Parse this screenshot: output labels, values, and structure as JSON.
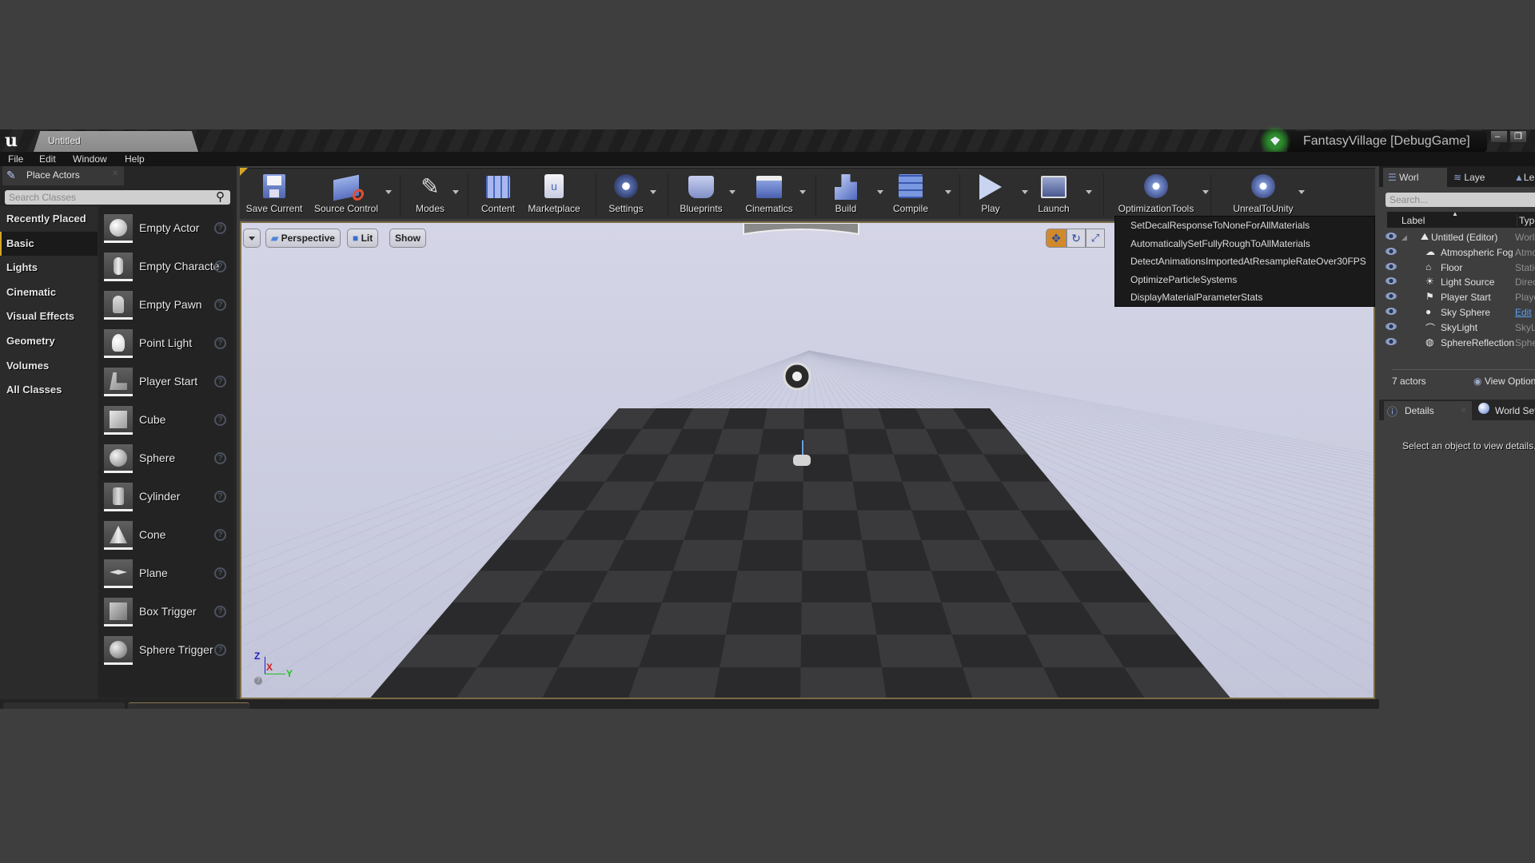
{
  "window": {
    "document_tab": "Untitled",
    "project_name": "FantasyVillage [DebugGame]",
    "minimize_glyph": "–",
    "restore_glyph": "❐"
  },
  "menu": [
    "File",
    "Edit",
    "Window",
    "Help"
  ],
  "place_actors": {
    "tab_label": "Place Actors",
    "search_placeholder": "Search Classes",
    "categories": [
      "Recently Placed",
      "Basic",
      "Lights",
      "Cinematic",
      "Visual Effects",
      "Geometry",
      "Volumes",
      "All Classes"
    ],
    "active_category": "Basic",
    "actors": [
      "Empty Actor",
      "Empty Character",
      "Empty Pawn",
      "Point Light",
      "Player Start",
      "Cube",
      "Sphere",
      "Cylinder",
      "Cone",
      "Plane",
      "Box Trigger",
      "Sphere Trigger"
    ],
    "help_glyph": "?"
  },
  "toolbar": {
    "buttons": [
      {
        "label": "Save Current",
        "icon": "save-icon"
      },
      {
        "label": "Source Control",
        "icon": "source-control-icon"
      },
      {
        "label": "Modes",
        "icon": "modes-icon"
      },
      {
        "label": "Content",
        "icon": "content-icon"
      },
      {
        "label": "Marketplace",
        "icon": "marketplace-icon"
      },
      {
        "label": "Settings",
        "icon": "settings-icon"
      },
      {
        "label": "Blueprints",
        "icon": "blueprints-icon"
      },
      {
        "label": "Cinematics",
        "icon": "cinematics-icon"
      },
      {
        "label": "Build",
        "icon": "build-icon"
      },
      {
        "label": "Compile",
        "icon": "compile-icon"
      },
      {
        "label": "Play",
        "icon": "play-icon"
      },
      {
        "label": "Launch",
        "icon": "launch-icon"
      },
      {
        "label": "OptimizationTools",
        "icon": "gear-icon"
      },
      {
        "label": "UnrealToUnity",
        "icon": "gear-icon"
      }
    ]
  },
  "optimization_menu": [
    "SetDecalResponseToNoneForAllMaterials",
    "AutomaticallySetFullyRoughToAllMaterials",
    "DetectAnimationsImportedAtResampleRateOver30FPS",
    "OptimizeParticleSystems",
    "DisplayMaterialParameterStats"
  ],
  "viewport": {
    "view_mode": "Perspective",
    "lighting": "Lit",
    "show": "Show",
    "axis": {
      "z": "Z",
      "x": "X",
      "y": "Y"
    }
  },
  "outliner": {
    "tabs": [
      "World Outliner",
      "Layers",
      "Levels"
    ],
    "tab_short": [
      "Worl",
      "Laye",
      "Le"
    ],
    "search_placeholder": "Search...",
    "columns": [
      "Label",
      "Type"
    ],
    "rows": [
      {
        "name": "Untitled (Editor)",
        "type": "World"
      },
      {
        "name": "Atmospheric Fog",
        "type": "AtmosphericFog"
      },
      {
        "name": "Floor",
        "type": "StaticMeshActor"
      },
      {
        "name": "Light Source",
        "type": "DirectionalLight"
      },
      {
        "name": "Player Start",
        "type": "PlayerStart"
      },
      {
        "name": "Sky Sphere",
        "type": "Edit"
      },
      {
        "name": "SkyLight",
        "type": "SkyLight"
      },
      {
        "name": "SphereReflectionCapture",
        "type": "SphereReflectionCapture"
      }
    ],
    "actor_count": "7 actors",
    "view_options": "View Options"
  },
  "details": {
    "tabs": [
      "Details",
      "World Settings"
    ],
    "empty_message": "Select an object to view details."
  }
}
